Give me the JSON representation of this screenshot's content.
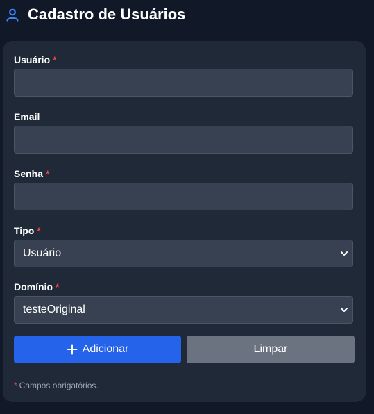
{
  "header": {
    "title": "Cadastro de Usuários",
    "icon": "user-icon",
    "icon_color": "#3b82f6"
  },
  "form": {
    "required_mark": "*",
    "usuario": {
      "label": "Usuário",
      "value": "",
      "required": true
    },
    "email": {
      "label": "Email",
      "value": "",
      "required": false
    },
    "senha": {
      "label": "Senha",
      "value": "",
      "required": true
    },
    "tipo": {
      "label": "Tipo",
      "selected": "Usuário",
      "required": true
    },
    "dominio": {
      "label": "Domínio",
      "selected": "testeOriginal",
      "required": true
    }
  },
  "buttons": {
    "add_label": "Adicionar",
    "add_icon": "plus-icon",
    "clear_label": "Limpar"
  },
  "footer": {
    "required_note_star": "*",
    "required_note": "Campos obrigatórios."
  },
  "colors": {
    "background": "#111827",
    "card": "#1f2937",
    "input": "#374151",
    "accent": "#2563eb",
    "secondary_button": "#6b7280",
    "required": "#ef4444"
  }
}
